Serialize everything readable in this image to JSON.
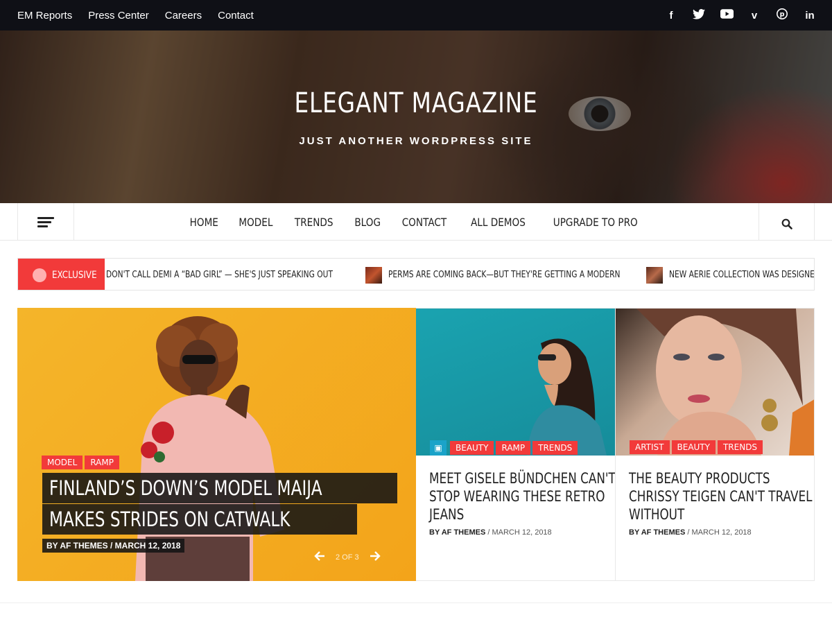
{
  "topbar": {
    "links": [
      "EM Reports",
      "Press Center",
      "Careers",
      "Contact"
    ],
    "social": [
      {
        "icon": "facebook-icon",
        "glyph": "f"
      },
      {
        "icon": "twitter-icon",
        "glyph": "t"
      },
      {
        "icon": "youtube-icon",
        "glyph": "▶"
      },
      {
        "icon": "vimeo-icon",
        "glyph": "v"
      },
      {
        "icon": "pinterest-icon",
        "glyph": "p"
      },
      {
        "icon": "linkedin-icon",
        "glyph": "in"
      }
    ]
  },
  "hero": {
    "site_title": "ELEGANT MAGAZINE",
    "tagline": "JUST ANOTHER WORDPRESS SITE"
  },
  "nav": {
    "items": [
      "HOME",
      "MODEL",
      "TRENDS",
      "BLOG",
      "CONTACT",
      "ALL DEMOS",
      "UPGRADE TO PRO"
    ],
    "menu_icon": "hamburger-icon",
    "search_icon": "search-icon"
  },
  "ticker": {
    "label": "EXCLUSIVE",
    "items": [
      "DON'T CALL DEMI A “BAD GIRL” — SHE'S JUST SPEAKING OUT",
      "PERMS ARE COMING BACK—BUT THEY'RE GETTING A MODERN",
      "NEW AERIE COLLECTION WAS DESIGNED"
    ]
  },
  "featured": {
    "tags": [
      "MODEL",
      "RAMP"
    ],
    "title_lines": [
      "FINLAND’S DOWN’S MODEL MAIJA",
      "MAKES STRIDES ON CATWALK"
    ],
    "meta": "BY AF THEMES  /  MARCH 12, 2018",
    "pager": "2 OF 3"
  },
  "cards": [
    {
      "tags": [
        "BEAUTY",
        "RAMP",
        "TRENDS"
      ],
      "title_lines": [
        "MEET GISELE BÜNDCHEN CAN'T",
        "STOP WEARING THESE RETRO",
        "JEANS"
      ],
      "author": "BY AF THEMES",
      "date": " / MARCH 12, 2018"
    },
    {
      "tags": [
        "ARTIST",
        "BEAUTY",
        "TRENDS"
      ],
      "title_lines": [
        "THE BEAUTY PRODUCTS",
        "CHRISSY TEIGEN CAN'T TRAVEL",
        "WITHOUT"
      ],
      "author": "BY AF THEMES",
      "date": " / MARCH 12, 2018"
    }
  ],
  "colors": {
    "accent": "#f23a3a",
    "topbar": "#0f1016",
    "featured_bg": "#f4b52a",
    "card1_bg": "#1aa3b0"
  }
}
